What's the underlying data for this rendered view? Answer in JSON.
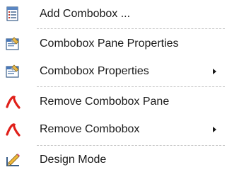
{
  "menu": {
    "items": [
      {
        "label": "Add Combobox ...",
        "icon": "add-combobox-icon",
        "submenu": false
      },
      {
        "label": "Combobox Pane Properties",
        "icon": "properties-icon",
        "submenu": false
      },
      {
        "label": "Combobox Properties",
        "icon": "properties-icon",
        "submenu": true
      },
      {
        "label": "Remove Combobox Pane",
        "icon": "remove-icon",
        "submenu": false
      },
      {
        "label": "Remove Combobox",
        "icon": "remove-icon",
        "submenu": true
      },
      {
        "label": "Design Mode",
        "icon": "design-mode-icon",
        "submenu": false
      }
    ]
  },
  "colors": {
    "remove_icon": "#e0201a",
    "separator": "#c8c8c8",
    "text": "#1a1a1a"
  }
}
